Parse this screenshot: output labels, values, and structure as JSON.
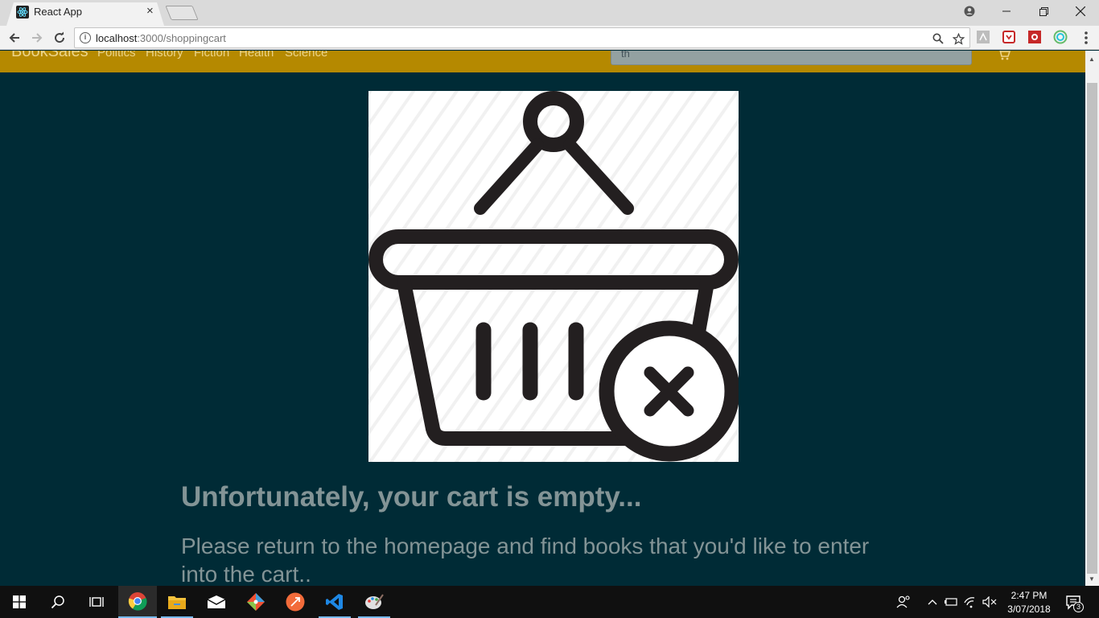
{
  "browser": {
    "tab_title": "React App",
    "tab_close": "×",
    "url_host": "localhost",
    "url_path": ":3000/shoppingcart"
  },
  "navbar": {
    "brand": "BookSales",
    "links": [
      "Politics",
      "History",
      "Fiction",
      "Health",
      "Science"
    ],
    "search_value": "th",
    "color": "#b58900"
  },
  "main": {
    "heading": "Unfortunately, your cart is empty...",
    "message": "Please return to the homepage and find books that you'd like to enter into the cart..",
    "background": "#002b36",
    "text_color": "#839496"
  },
  "taskbar": {
    "clock_time": "2:47 PM",
    "clock_date": "3/07/2018",
    "notification_count": "3"
  }
}
